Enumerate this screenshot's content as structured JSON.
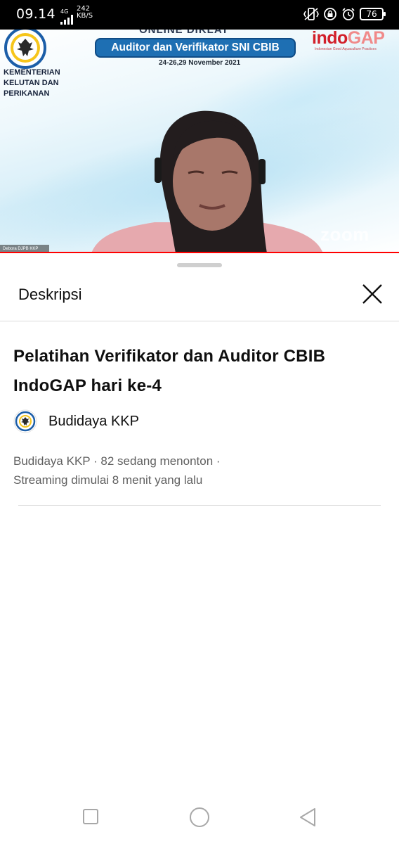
{
  "status_bar": {
    "time": "09.14",
    "network_type": "4G",
    "net_speed_value": "242",
    "net_speed_unit": "KB/S",
    "battery": "76",
    "icons": [
      "signal-icon",
      "vibrate-icon",
      "lock-rotation-icon",
      "alarm-icon",
      "battery-icon"
    ]
  },
  "video": {
    "ministry_name": [
      "KEMENTERIAN",
      "KELUTAN DAN",
      "PERIKANAN"
    ],
    "banner_top": "ONLINE DIKLAT",
    "banner_title": "Auditor dan Verifikator SNI CBIB",
    "banner_date": "24-26,29 November 2021",
    "brand_prefix": "indo",
    "brand_suffix": "GAP",
    "brand_tagline": "Indonesian Good Aquaculture Practices",
    "watermark": "zoom",
    "participant_name": "Debora DJPB KKP",
    "accent_color": "#ff0000"
  },
  "sheet": {
    "title": "Deskripsi",
    "video_title": "Pelatihan Verifikator dan Auditor CBIB IndoGAP hari ke-4",
    "channel_name": "Budidaya KKP",
    "meta_line1": "Budidaya KKP · 82 sedang menonton ·",
    "meta_line2": "Streaming dimulai 8 menit yang lalu"
  },
  "nav_bar": {
    "buttons": [
      "recent-apps",
      "home",
      "back"
    ]
  }
}
